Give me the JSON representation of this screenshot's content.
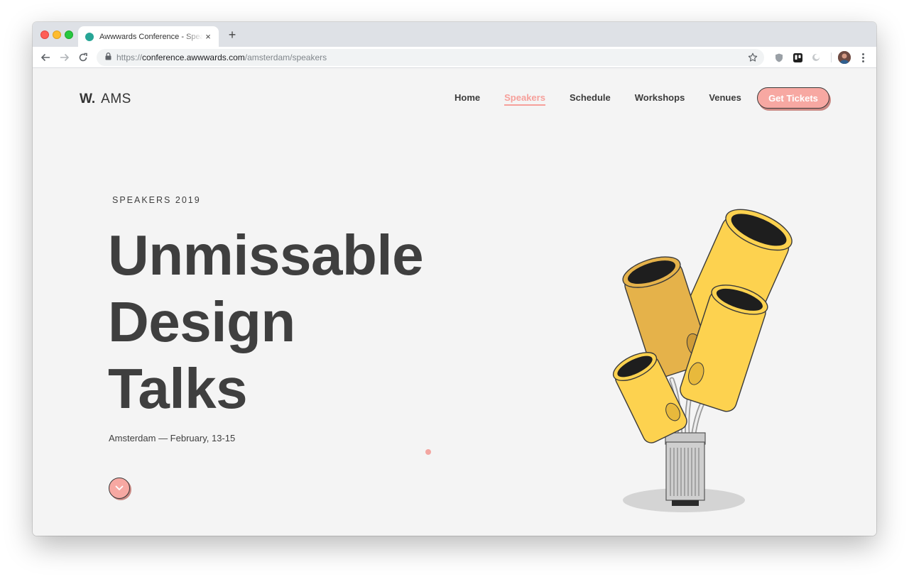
{
  "browser": {
    "tab": {
      "title": "Awwwards Conference - Speakers",
      "close": "×"
    },
    "new_tab": "+",
    "url": {
      "scheme": "https://",
      "host": "conference.awwwards.com",
      "path": "/amsterdam/speakers"
    }
  },
  "header": {
    "logo_mark": "W.",
    "logo_text": "AMS",
    "nav": [
      {
        "label": "Home",
        "active": false
      },
      {
        "label": "Speakers",
        "active": true
      },
      {
        "label": "Schedule",
        "active": false
      },
      {
        "label": "Workshops",
        "active": false
      },
      {
        "label": "Venues",
        "active": false
      }
    ],
    "cta": "Get Tickets"
  },
  "hero": {
    "eyebrow": "SPEAKERS 2019",
    "headline": [
      "Unmissable",
      "Design",
      "Talks"
    ],
    "subline": "Amsterdam — February, 13-15"
  },
  "icons": {
    "back": "back-arrow-icon",
    "forward": "forward-arrow-icon",
    "reload": "reload-icon",
    "lock": "lock-icon",
    "bookmark": "star-icon",
    "scroll": "chevron-down-icon"
  },
  "colors": {
    "accent": "#f7a8a2",
    "text": "#3f3f3f",
    "background": "#f4f4f4",
    "tab_favicon": "#27a596",
    "illustration_yellow": "#fdd24f"
  }
}
